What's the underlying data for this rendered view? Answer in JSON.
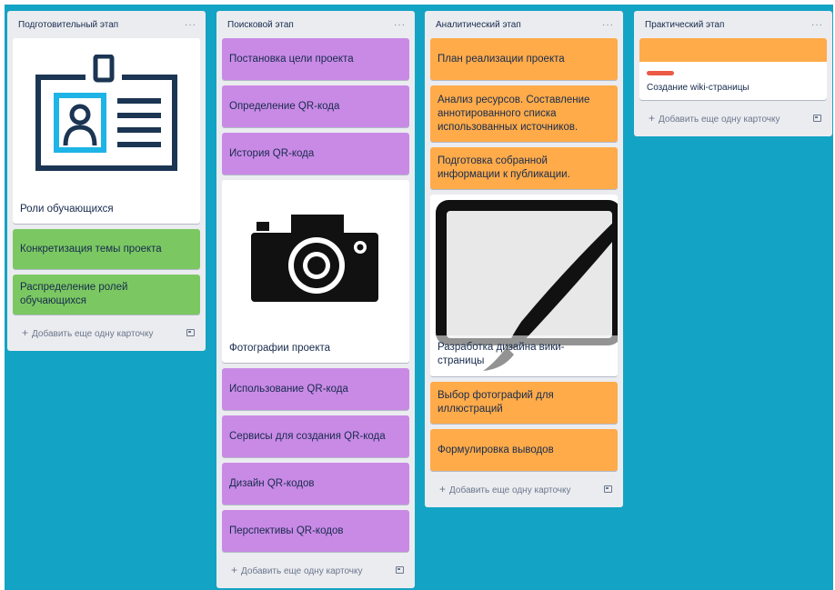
{
  "lists": [
    {
      "title": "Подготовительный этап",
      "menu": "···",
      "cards": [
        {
          "kind": "image",
          "image": "id-badge-icon",
          "title": "Роли обучающихся"
        },
        {
          "kind": "color",
          "title": "Конкретизация темы проекта"
        },
        {
          "kind": "color",
          "title": "Распределение ролей обучающихся"
        }
      ],
      "color": "#7bc862",
      "add_label": "Добавить еще одну карточку"
    },
    {
      "title": "Поисковой этап",
      "menu": "···",
      "cards": [
        {
          "kind": "color",
          "title": "Постановка цели проекта"
        },
        {
          "kind": "color",
          "title": "Определение QR-кода"
        },
        {
          "kind": "color",
          "title": "История QR-кода"
        },
        {
          "kind": "image",
          "image": "camera-icon",
          "title": "Фотографии проекта"
        },
        {
          "kind": "color",
          "title": "Использование QR-кода"
        },
        {
          "kind": "color",
          "title": "Сервисы для создания QR-кода"
        },
        {
          "kind": "color",
          "title": "Дизайн QR-кодов"
        },
        {
          "kind": "color",
          "title": "Перспективы QR-кодов"
        }
      ],
      "color": "#c98ae6",
      "add_label": "Добавить еще одну карточку"
    },
    {
      "title": "Аналитический этап",
      "menu": "···",
      "cards": [
        {
          "kind": "color",
          "title": "План реализации проекта"
        },
        {
          "kind": "color",
          "title": "Анализ ресурсов. Составление аннотированного списка использованных источников."
        },
        {
          "kind": "color",
          "title": "Подготовка собранной информации к публикации."
        },
        {
          "kind": "image",
          "image": "monitor-brush-icon",
          "title": "Разработка дизайна вики-страницы"
        },
        {
          "kind": "color",
          "title": "Выбор фотографий для иллюстраций"
        },
        {
          "kind": "color",
          "title": "Формулировка выводов"
        }
      ],
      "color": "#ffab4a",
      "add_label": "Добавить еще одну карточку"
    },
    {
      "title": "Практический этап",
      "menu": "···",
      "cards": [
        {
          "kind": "cover",
          "title": "Создание wiki-страницы",
          "label_color": "#eb5a46"
        }
      ],
      "color": "#ffab4a",
      "add_label": "Добавить еще одну карточку"
    }
  ],
  "colors": {
    "board": "#13a3c4",
    "list": "#ebecf0",
    "green": "#7bc862",
    "purple": "#c98ae6",
    "orange": "#ffab4a",
    "red": "#eb5a46"
  }
}
